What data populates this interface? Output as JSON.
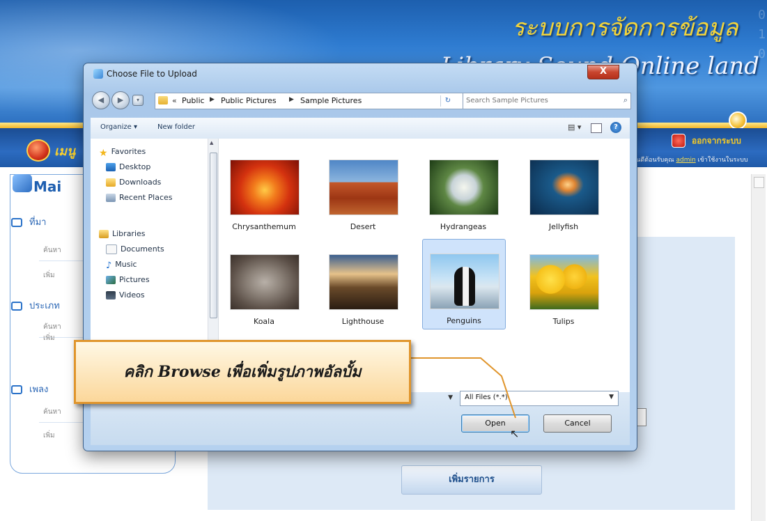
{
  "app": {
    "header_title_th": "ระบบการจัดการข้อมูล",
    "header_title_en": "Library Sound Online land",
    "nav_home": "เมนู",
    "logout": "ออกจากระบบ",
    "user_line_prefix": "ยินดีต้อนรับคุณ",
    "user_name": "admin",
    "user_line_suffix": "เข้าใช้งานในระบบ",
    "main_label": "Mai",
    "sidebar": [
      {
        "label": "ที่มา",
        "subs": [
          "ค้นหา",
          "เพิ่ม"
        ]
      },
      {
        "label": "ประเภท",
        "subs": [
          "ค้นหา",
          "เพิ่ม"
        ]
      },
      {
        "label": "เพลง",
        "subs": [
          "ค้นหา",
          "เพิ่ม"
        ]
      }
    ],
    "add_button": "เพิ่มรายการ"
  },
  "dialog": {
    "title": "Choose File to Upload",
    "close_label": "X",
    "address": {
      "prefix": "«",
      "crumbs": [
        "Public",
        "Public Pictures",
        "Sample Pictures"
      ]
    },
    "search_placeholder": "Search Sample Pictures",
    "toolbar": {
      "organize": "Organize ▾",
      "new_folder": "New folder",
      "help": "?"
    },
    "nav": {
      "favorites": "Favorites",
      "desktop": "Desktop",
      "downloads": "Downloads",
      "recent": "Recent Places",
      "libraries": "Libraries",
      "documents": "Documents",
      "music": "Music",
      "pictures": "Pictures",
      "videos": "Videos"
    },
    "files": [
      {
        "name": "Chrysanthemum",
        "selected": false
      },
      {
        "name": "Desert",
        "selected": false
      },
      {
        "name": "Hydrangeas",
        "selected": false
      },
      {
        "name": "Jellyfish",
        "selected": false
      },
      {
        "name": "Koala",
        "selected": false
      },
      {
        "name": "Lighthouse",
        "selected": false
      },
      {
        "name": "Penguins",
        "selected": true
      },
      {
        "name": "Tulips",
        "selected": false
      }
    ],
    "file_type_filter": "All Files (*.*)",
    "open_label": "Open",
    "cancel_label": "Cancel"
  },
  "callout": {
    "text": "คลิก Browse เพื่อเพิ่มรูปภาพอัลบั้ม",
    "accent": "#e0952c"
  }
}
